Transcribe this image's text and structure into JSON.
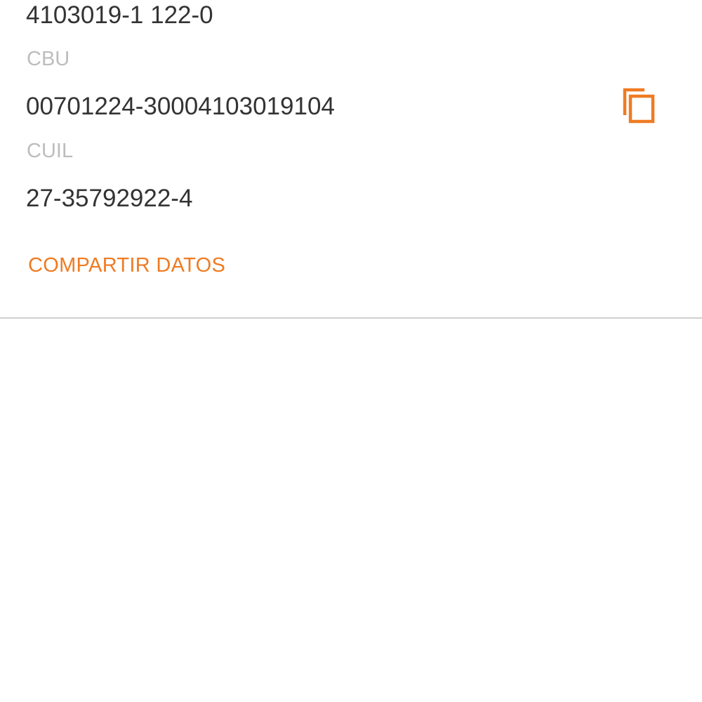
{
  "account": {
    "number": "4103019-1 122-0"
  },
  "cbu": {
    "label": "CBU",
    "value": "00701224-30004103019104",
    "copy_icon": "copy-icon"
  },
  "cuil": {
    "label": "CUIL",
    "value": "27-35792922-4"
  },
  "actions": {
    "share_label": "COMPARTIR DATOS"
  },
  "colors": {
    "accent": "#ef7b23",
    "value_text": "#333333",
    "label_text": "#bdbdbd",
    "divider": "#cfcfcf",
    "background": "#ffffff"
  }
}
